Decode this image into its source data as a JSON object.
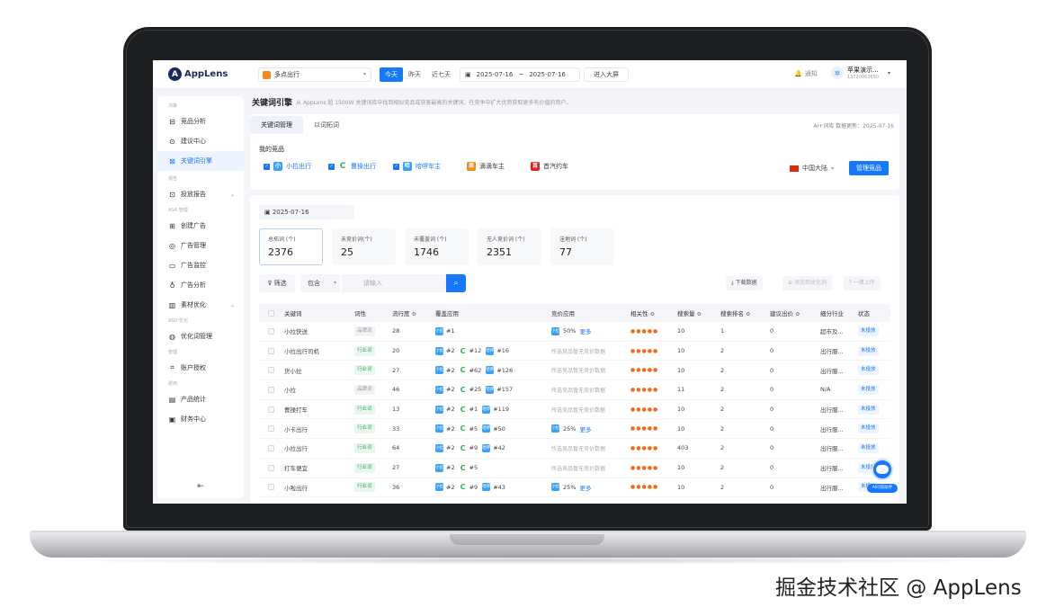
{
  "watermark": "掘金技术社区 @ AppLens",
  "app": {
    "logo_letter": "A",
    "logo_text": "AppLens"
  },
  "topbar": {
    "app_select": "多点出行",
    "date_tabs": [
      "今天",
      "昨天",
      "近七天"
    ],
    "date_start": "2025-07-16",
    "date_sep": "~",
    "date_end": "2025-07-16",
    "big_screen": "进入大屏",
    "notify": "通知",
    "user_avatar": "苹",
    "user_name": "苹果演示...",
    "user_phone": "13720063650"
  },
  "sidebar": {
    "sections": [
      {
        "label": "决策",
        "items": [
          {
            "label": "竞品分析",
            "icon": "monitor-icon"
          },
          {
            "label": "建议中心",
            "icon": "location-icon"
          },
          {
            "label": "关键词引擎",
            "icon": "keyword-icon",
            "active": true
          }
        ]
      },
      {
        "label": "报告",
        "items": [
          {
            "label": "投放报告",
            "icon": "report-icon",
            "expand": true
          }
        ]
      },
      {
        "label": "ASA 管理",
        "items": [
          {
            "label": "创建广告",
            "icon": "create-icon"
          },
          {
            "label": "广告管理",
            "icon": "ads-icon"
          },
          {
            "label": "广告监控",
            "icon": "monitor-icon"
          },
          {
            "label": "广告分析",
            "icon": "analysis-icon"
          },
          {
            "label": "素材优化",
            "icon": "chart-icon",
            "expand": true
          }
        ]
      },
      {
        "label": "ASO 优化",
        "items": [
          {
            "label": "优化词管理",
            "icon": "optimize-icon"
          }
        ]
      },
      {
        "label": "管理",
        "items": [
          {
            "label": "账户授权",
            "icon": "auth-icon"
          }
        ]
      },
      {
        "label": "费用",
        "items": [
          {
            "label": "产品统计",
            "icon": "stats-icon"
          },
          {
            "label": "财务中心",
            "icon": "finance-icon"
          }
        ]
      }
    ],
    "collapse_icon": "collapse-icon"
  },
  "page": {
    "title": "关键词引擎",
    "desc": "从 AppLens 超 1500W 关键词库中找到相似竞品或获客最高的关键词，在竞争中扩大优势获取更多有价值的用户。",
    "tabs": [
      "关键词管理",
      "以词拓词"
    ],
    "data_update": "AI+词库 数据更新：2025-07-16",
    "my_competitors": "我的竞品",
    "competitors": [
      {
        "name": "小拉出行",
        "checked": true,
        "icon_text": "小拉",
        "color": "#39a0f7"
      },
      {
        "name": "曹操出行",
        "checked": true,
        "icon_text": "C",
        "color": "#2ab35c"
      },
      {
        "name": "哈啰车主",
        "checked": true,
        "icon_text": "哈啰",
        "color": "#39a0f7"
      },
      {
        "name": "滴滴车主",
        "checked": false,
        "icon_text": "滴",
        "color": "#f28b1c"
      },
      {
        "name": "首汽约车",
        "checked": false,
        "icon_text": "首",
        "color": "#d7291f"
      }
    ],
    "region": "中国大陆",
    "manage_btn": "管理竞品"
  },
  "content": {
    "date": "2025-07-16",
    "stats": [
      {
        "label": "总拓词 (个)",
        "value": "2376",
        "active": true
      },
      {
        "label": "未竞价词(个)",
        "value": "25"
      },
      {
        "label": "未覆盖词 (个)",
        "value": "1746"
      },
      {
        "label": "无人竞价词 (个)",
        "value": "2351"
      },
      {
        "label": "洼地词 (个)",
        "value": "77"
      }
    ],
    "filter": "筛选",
    "contains": "包含",
    "search_placeholder": "请输入",
    "download": "下载数据",
    "add_optimize": "添加到优化词",
    "one_click": "一键上传",
    "columns": [
      "关键词",
      "词性",
      "流行度 ≎",
      "覆盖应用",
      "竞价应用",
      "相关性 ≎",
      "搜索量 ≎",
      "搜索排名 ≎",
      "建议出价 ≎",
      "细分行业",
      "状态"
    ],
    "rows": [
      {
        "kw": "小拉快送",
        "type": "品牌词",
        "tclass": "brand",
        "pop": "28",
        "cover": [
          [
            "小拉",
            "blue",
            "#1"
          ]
        ],
        "bid": "50%",
        "bid_more": "更多",
        "bid_icon": "blue",
        "rel": "●●●●●",
        "vol": "10",
        "rank": "1",
        "price": "0",
        "ind": "超市及...",
        "status": "未投放"
      },
      {
        "kw": "小拉出行司机",
        "type": "行业词",
        "tclass": "industry",
        "pop": "20",
        "cover": [
          [
            "小拉",
            "blue",
            "#2"
          ],
          [
            "C",
            "c",
            "#12"
          ],
          [
            "哈啰",
            "blue",
            "#16"
          ]
        ],
        "bid_nodata": "所选竞品暂无竞价数据",
        "rel": "●●●●●",
        "vol": "10",
        "rank": "2",
        "price": "0",
        "ind": "出行服...",
        "status": "未投放"
      },
      {
        "kw": "货小拉",
        "type": "行业词",
        "tclass": "industry",
        "pop": "27",
        "cover": [
          [
            "小拉",
            "blue",
            "#2"
          ],
          [
            "C",
            "c",
            "#62"
          ],
          [
            "哈啰",
            "blue",
            "#126"
          ]
        ],
        "bid_nodata": "所选竞品暂无竞价数据",
        "rel": "●●●●●",
        "vol": "10",
        "rank": "2",
        "price": "0",
        "ind": "出行服...",
        "status": "未投放"
      },
      {
        "kw": "小拉",
        "type": "品牌词",
        "tclass": "brand",
        "pop": "46",
        "cover": [
          [
            "小拉",
            "blue",
            "#2"
          ],
          [
            "C",
            "c",
            "#25"
          ],
          [
            "哈啰",
            "blue",
            "#157"
          ]
        ],
        "bid_nodata": "所选竞品暂无竞价数据",
        "rel": "●●●●●",
        "vol": "11",
        "rank": "2",
        "price": "0",
        "ind": "N/A",
        "status": "未投放"
      },
      {
        "kw": "曹操打车",
        "type": "行业词",
        "tclass": "industry",
        "pop": "13",
        "cover": [
          [
            "小拉",
            "blue",
            "#2"
          ],
          [
            "C",
            "c",
            "#1"
          ],
          [
            "哈啰",
            "blue",
            "#119"
          ]
        ],
        "bid_nodata": "所选竞品暂无竞价数据",
        "rel": "●●●●●",
        "vol": "10",
        "rank": "2",
        "price": "0",
        "ind": "出行服...",
        "status": "未投放"
      },
      {
        "kw": "小卡出行",
        "type": "行业词",
        "tclass": "industry",
        "pop": "33",
        "cover": [
          [
            "小拉",
            "blue",
            "#2"
          ],
          [
            "C",
            "c",
            "#5"
          ],
          [
            "哈啰",
            "blue",
            "#50"
          ]
        ],
        "bid": "25%",
        "bid_more": "更多",
        "bid_icon": "blue",
        "rel": "●●●●●",
        "vol": "10",
        "rank": "2",
        "price": "0",
        "ind": "出行服...",
        "status": "未投放"
      },
      {
        "kw": "小拉出行",
        "type": "行业词",
        "tclass": "industry",
        "pop": "64",
        "cover": [
          [
            "小拉",
            "blue",
            "#2"
          ],
          [
            "C",
            "c",
            "#9"
          ],
          [
            "哈啰",
            "blue",
            "#42"
          ]
        ],
        "bid_nodata": "所选竞品暂无竞价数据",
        "rel": "●●●●●",
        "vol": "403",
        "rank": "2",
        "price": "0",
        "ind": "出行服...",
        "status": "未投放"
      },
      {
        "kw": "打车便宜",
        "type": "行业词",
        "tclass": "industry",
        "pop": "27",
        "cover": [
          [
            "小拉",
            "blue",
            "#2"
          ],
          [
            "C",
            "c",
            "#5"
          ]
        ],
        "bid_nodata": "所选竞品暂无竞价数据",
        "rel": "●●●●●",
        "vol": "10",
        "rank": "2",
        "price": "0",
        "ind": "出行服...",
        "status": "未投放"
      },
      {
        "kw": "小啦出行",
        "type": "行业词",
        "tclass": "industry",
        "pop": "36",
        "cover": [
          [
            "小拉",
            "blue",
            "#2"
          ],
          [
            "C",
            "c",
            "#9"
          ],
          [
            "哈啰",
            "blue",
            "#43"
          ]
        ],
        "bid": "25%",
        "bid_more": "更多",
        "bid_icon": "blue",
        "rel": "●●●●●",
        "vol": "10",
        "rank": "2",
        "price": "0",
        "ind": "出行服...",
        "status": "未投放"
      }
    ],
    "assistant": "AI问答助手"
  },
  "colors": {
    "accent": "#1677ff",
    "relevance": "#f26a1b",
    "industry_tag": "#3daa5c",
    "logo": "#1b2a57"
  }
}
